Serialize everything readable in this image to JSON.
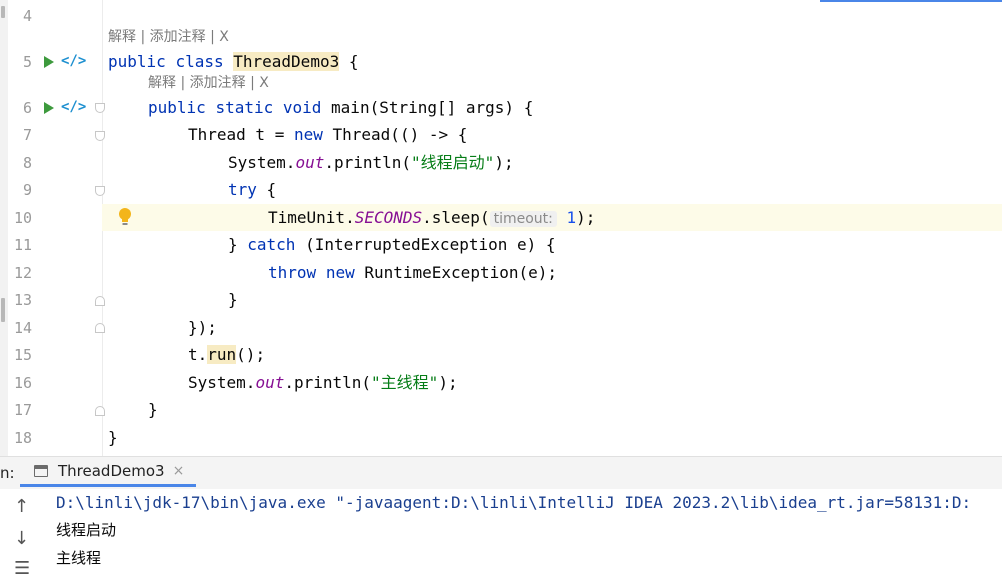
{
  "editor": {
    "hint_label": "解释 | 添加注释 | X",
    "line_numbers": [
      "4",
      "5",
      "6",
      "7",
      "8",
      "9",
      "10",
      "11",
      "12",
      "13",
      "14",
      "15",
      "16",
      "17",
      "18"
    ],
    "code": {
      "l5": {
        "kw1": "public",
        "kw2": "class",
        "cls": "ThreadDemo3",
        "rest": " {"
      },
      "l6": {
        "kw1": "public",
        "kw2": "static",
        "kw3": "void",
        "rest": " main(String[] args) {"
      },
      "l7": {
        "a": "Thread t = ",
        "kw": "new",
        "b": " Thread(() -> {"
      },
      "l8": {
        "a": "System.",
        "fld": "out",
        "b": ".println(",
        "str": "\"线程启动\"",
        "c": ");"
      },
      "l9": {
        "kw": "try",
        "b": " {"
      },
      "l10": {
        "a": "TimeUnit.",
        "fld": "SECONDS",
        "b": ".sleep(",
        "inlay": "timeout:",
        "num": "1",
        "c": ");"
      },
      "l11": {
        "a": "} ",
        "kw": "catch",
        "b": " (InterruptedException e) {"
      },
      "l12": {
        "kw1": "throw",
        "kw2": "new",
        "b": " RuntimeException(e);"
      },
      "l13": "}",
      "l14": "});",
      "l15": {
        "a": "t.",
        "hl": "run",
        "b": "();"
      },
      "l16": {
        "a": "System.",
        "fld": "out",
        "b": ".println(",
        "str": "\"主线程\"",
        "c": ");"
      },
      "l17": "}",
      "l18": "}"
    }
  },
  "toolwindow": {
    "prefix": "n:",
    "tab_label": "ThreadDemo3",
    "tab_close": "×"
  },
  "console": {
    "command": "D:\\linli\\jdk-17\\bin\\java.exe \"-javaagent:D:\\linli\\IntelliJ IDEA 2023.2\\lib\\idea_rt.jar=58131:D:",
    "out1": "线程启动",
    "out2": "主线程"
  },
  "icons": {
    "run": "run-triangle-icon",
    "implement": "implement-link-icon",
    "bulb": "lightbulb-icon",
    "up": "arrow-up-icon",
    "down": "arrow-down-icon",
    "menu": "menu-icon"
  },
  "colors": {
    "keyword": "#0033b3",
    "string": "#067d17",
    "field": "#871094",
    "number": "#1750eb",
    "accent": "#4a86e8"
  }
}
